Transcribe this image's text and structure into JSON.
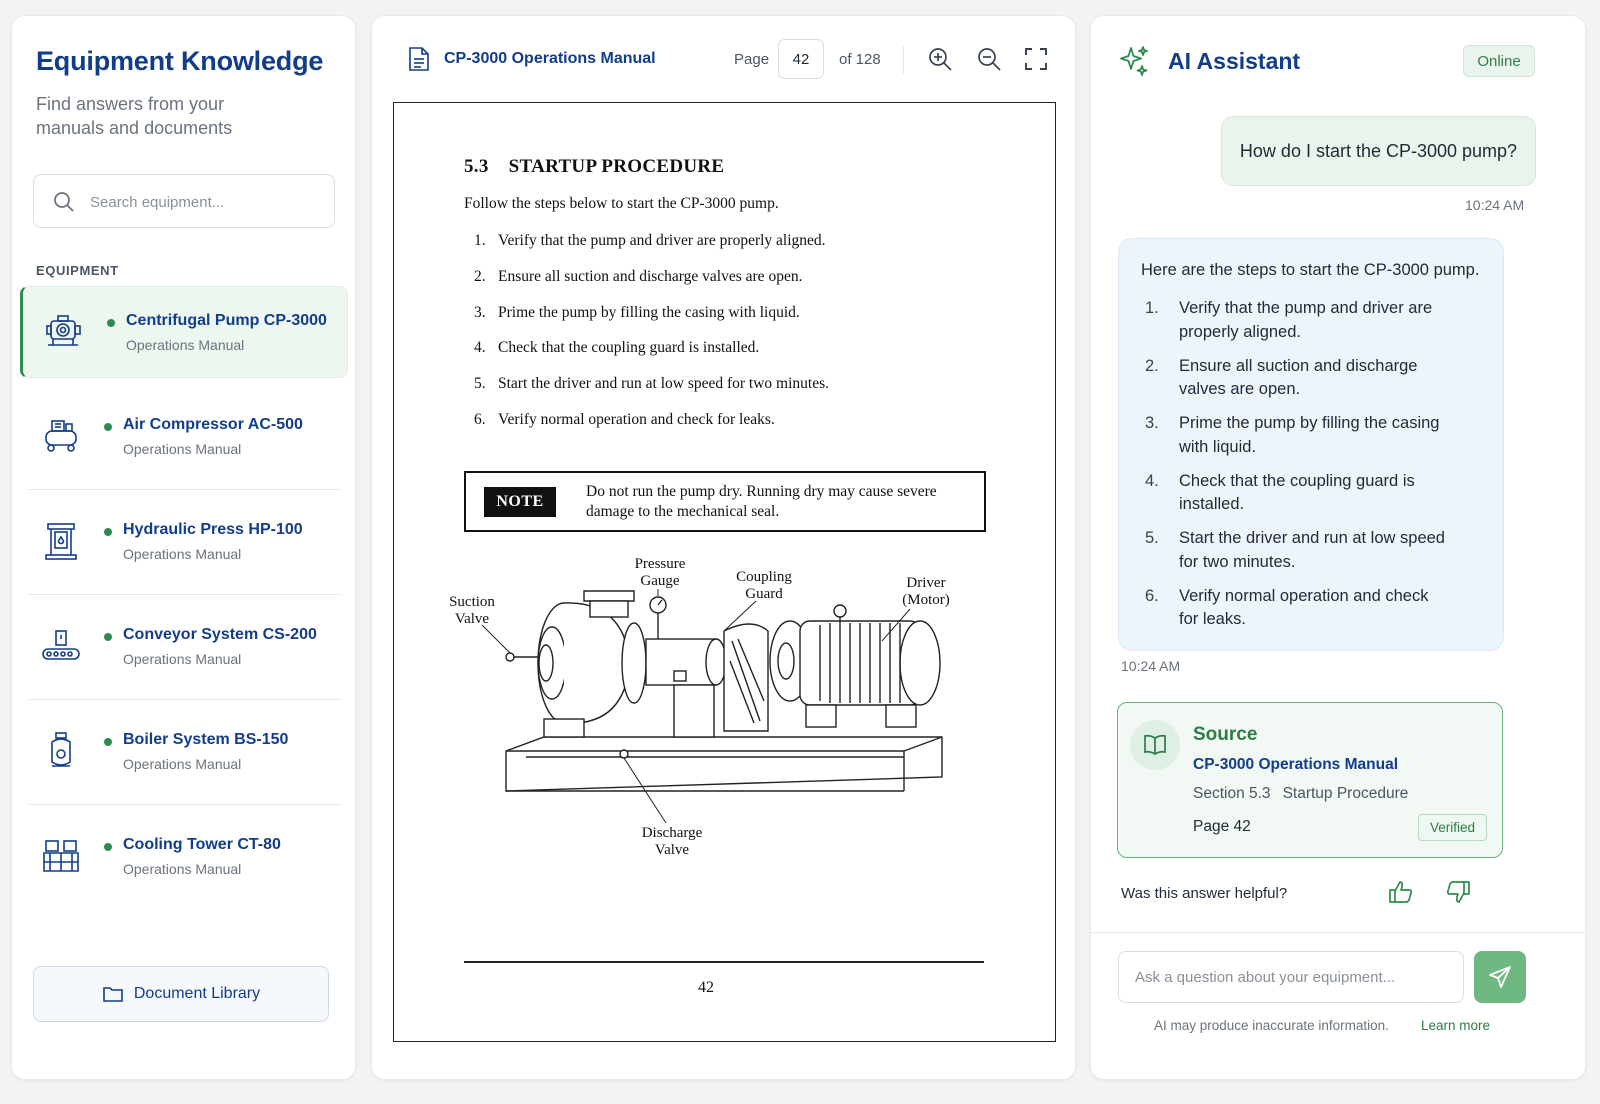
{
  "sidebar": {
    "title": "Equipment Knowledge",
    "subtitle": "Find answers from your manuals and documents",
    "search_placeholder": "Search equipment...",
    "section_label": "EQUIPMENT",
    "items": [
      {
        "name": "Centrifugal Pump CP-3000",
        "type": "Operations Manual",
        "icon": "pump-icon",
        "active": true
      },
      {
        "name": "Air Compressor AC-500",
        "type": "Operations Manual",
        "icon": "compressor-icon",
        "active": false
      },
      {
        "name": "Hydraulic Press HP-100",
        "type": "Operations Manual",
        "icon": "press-icon",
        "active": false
      },
      {
        "name": "Conveyor System CS-200",
        "type": "Operations Manual",
        "icon": "conveyor-icon",
        "active": false
      },
      {
        "name": "Boiler System BS-150",
        "type": "Operations Manual",
        "icon": "boiler-icon",
        "active": false
      },
      {
        "name": "Cooling Tower CT-80",
        "type": "Operations Manual",
        "icon": "cooling-tower-icon",
        "active": false
      }
    ],
    "library_label": "Document Library"
  },
  "viewer": {
    "doc_title": "CP-3000 Operations Manual",
    "page_label": "Page",
    "page_value": "42",
    "page_total": "of 128",
    "page": {
      "section_number": "5.3",
      "section_title": "STARTUP PROCEDURE",
      "intro": "Follow the steps below to start the CP-3000 pump.",
      "steps": [
        {
          "n": "1.",
          "text": "Verify that the pump and driver are properly aligned."
        },
        {
          "n": "2.",
          "text": "Ensure all suction and discharge valves are open."
        },
        {
          "n": "3.",
          "text": "Prime the pump by filling the casing with liquid."
        },
        {
          "n": "4.",
          "text": "Check that the coupling guard is installed."
        },
        {
          "n": "5.",
          "text": "Start the driver and run at low speed for two minutes."
        },
        {
          "n": "6.",
          "text": "Verify normal operation and check for leaks."
        }
      ],
      "note_tag": "NOTE",
      "note_text": "Do not run the pump dry.  Running dry may cause severe damage to the mechanical seal.",
      "diagram_labels": {
        "suction_valve": [
          "Suction",
          "Valve"
        ],
        "pressure_gauge": [
          "Pressure",
          "Gauge"
        ],
        "coupling_guard": [
          "Coupling",
          "Guard"
        ],
        "driver": [
          "Driver",
          "(Motor)"
        ],
        "discharge_valve": [
          "Discharge",
          "Valve"
        ]
      },
      "page_number": "42"
    }
  },
  "assistant": {
    "title": "AI Assistant",
    "status": "Online",
    "user_message": "How do I start the CP-3000 pump?",
    "user_time": "10:24 AM",
    "bot_lead": "Here are the steps to start the CP-3000 pump.",
    "bot_steps": [
      {
        "n": "1.",
        "text": "Verify that the pump and driver are properly aligned."
      },
      {
        "n": "2.",
        "text": "Ensure all suction and discharge valves are open."
      },
      {
        "n": "3.",
        "text": "Prime the pump by filling the casing with liquid."
      },
      {
        "n": "4.",
        "text": "Check that the coupling guard is installed."
      },
      {
        "n": "5.",
        "text": "Start the driver and run at low speed for two minutes."
      },
      {
        "n": "6.",
        "text": "Verify normal operation and check for leaks."
      }
    ],
    "bot_time": "10:24 AM",
    "source": {
      "title": "Source",
      "doc": "CP-3000 Operations Manual",
      "section_number": "Section 5.3",
      "section_name": "Startup Procedure",
      "page": "Page 42",
      "badge": "Verified"
    },
    "helpful_prompt": "Was this answer helpful?",
    "input_placeholder": "Ask a question about your equipment...",
    "disclaimer": "AI may produce inaccurate information.",
    "learn_more": "Learn more"
  },
  "colors": {
    "brand_blue": "#123d8a",
    "accent_green": "#2e8b4f",
    "send_green": "#6fb882"
  }
}
